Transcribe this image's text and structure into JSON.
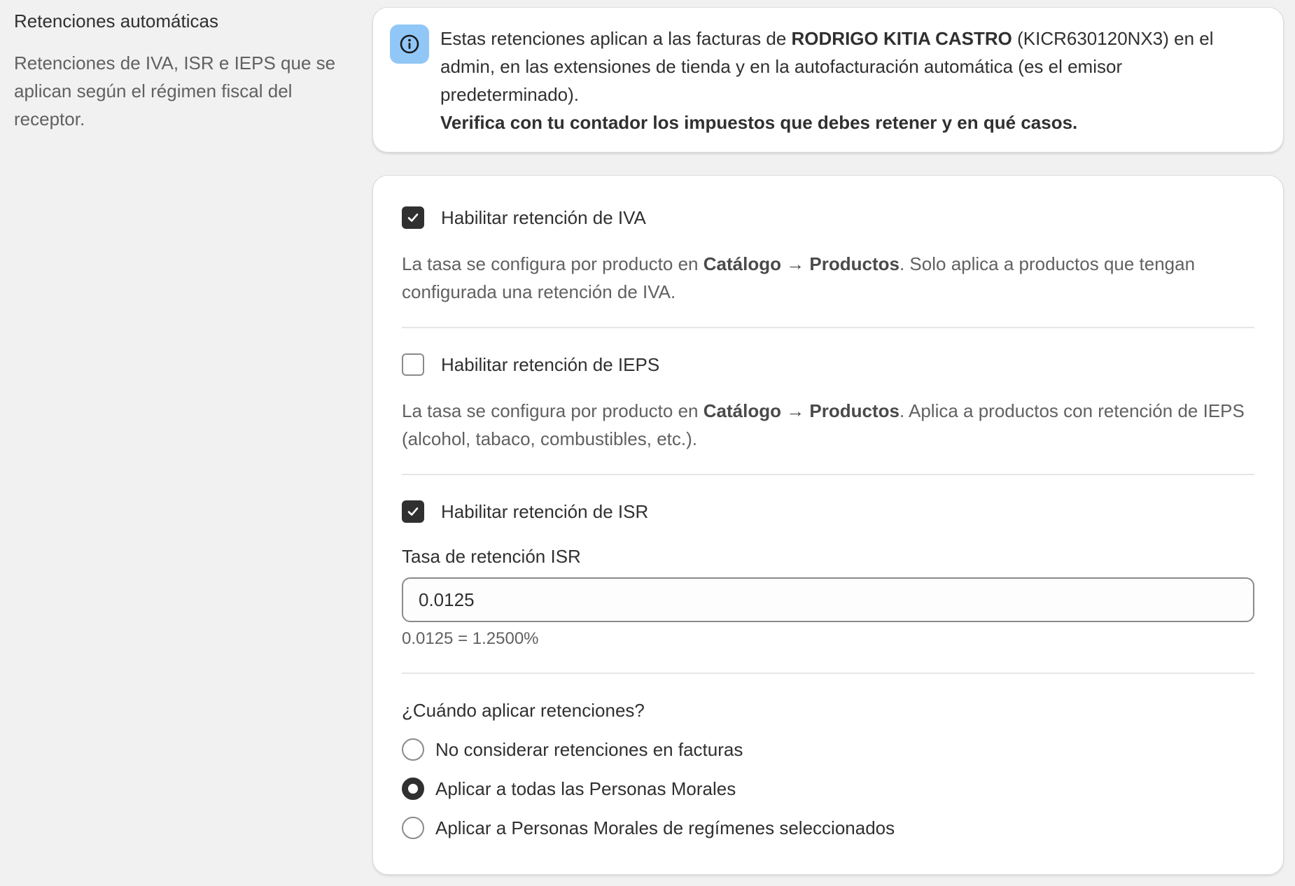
{
  "section": {
    "title": "Retenciones automáticas",
    "description": "Retenciones de IVA, ISR e IEPS que se aplican según el régimen fiscal del receptor."
  },
  "banner": {
    "icon": "info-icon",
    "text_before": "Estas retenciones aplican a las facturas de ",
    "issuer_name": "RODRIGO KITIA CASTRO",
    "text_after": " (KICR630120NX3) en el admin, en las extensiones de tienda y en la autofacturación automática (es el emisor predeterminado).",
    "warning": "Verifica con tu contador los impuestos que debes retener y en qué casos."
  },
  "iva": {
    "label": "Habilitar retención de IVA",
    "checked": true,
    "help_before": "La tasa se configura por producto en ",
    "help_path": "Catálogo → Productos",
    "help_after": ". Solo aplica a productos que tengan configurada una retención de IVA."
  },
  "ieps": {
    "label": "Habilitar retención de IEPS",
    "checked": false,
    "help_before": "La tasa se configura por producto en ",
    "help_path": "Catálogo → Productos",
    "help_after": ". Aplica a productos con retención de IEPS (alcohol, tabaco, combustibles, etc.)."
  },
  "isr": {
    "label": "Habilitar retención de ISR",
    "checked": true,
    "rate_label": "Tasa de retención ISR",
    "rate_value": "0.0125",
    "rate_help": "0.0125 = 1.2500%"
  },
  "when": {
    "question": "¿Cuándo aplicar retenciones?",
    "options": [
      {
        "label": "No considerar retenciones en facturas",
        "selected": false
      },
      {
        "label": "Aplicar a todas las Personas Morales",
        "selected": true
      },
      {
        "label": "Aplicar a Personas Morales de regímenes seleccionados",
        "selected": false
      }
    ]
  },
  "colors": {
    "checked_fill": "#303030",
    "info_icon_bg": "#91c7f7"
  }
}
